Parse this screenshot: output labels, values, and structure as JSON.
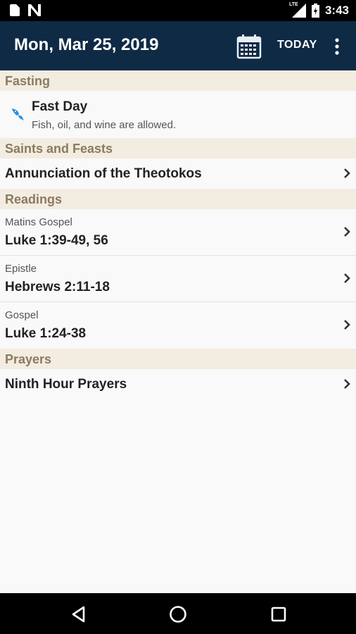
{
  "status_bar": {
    "time": "3:43",
    "network": "LTE",
    "icons": [
      "notification-file-icon",
      "n-logo-icon",
      "signal-icon",
      "battery-icon"
    ]
  },
  "app_bar": {
    "title": "Mon, Mar 25, 2019",
    "today_label": "TODAY",
    "icons": [
      "calendar-icon",
      "overflow-menu-icon"
    ],
    "bar_color": "#0f2a45"
  },
  "fasting": {
    "header": "Fasting",
    "title": "Fast Day",
    "description": "Fish, oil, and wine are allowed."
  },
  "saints": {
    "header": "Saints and Feasts",
    "items": [
      {
        "title": "Annunciation of the Theotokos"
      }
    ]
  },
  "readings": {
    "header": "Readings",
    "items": [
      {
        "label": "Matins Gospel",
        "reference": "Luke 1:39-49, 56"
      },
      {
        "label": "Epistle",
        "reference": "Hebrews 2:11-18"
      },
      {
        "label": "Gospel",
        "reference": "Luke 1:24-38"
      }
    ]
  },
  "prayers": {
    "header": "Prayers",
    "items": [
      {
        "title": "Ninth Hour Prayers"
      }
    ]
  },
  "colors": {
    "section_header_bg": "#f3ece0",
    "section_header_text": "#8c7a60",
    "fast_icon": "#2b8fe0"
  }
}
